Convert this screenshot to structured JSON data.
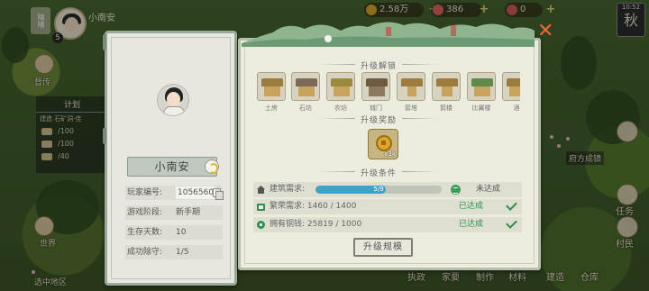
{
  "hud": {
    "player_name_top": "小南安",
    "player_level": "5",
    "weather_label": "晴晴",
    "resources": [
      {
        "icon": "copper-coin-icon",
        "value": "2.58万",
        "color": "#d9a52b"
      },
      {
        "icon": "scroll-icon",
        "value": "386",
        "color": "#e0665c"
      },
      {
        "icon": "gem-icon",
        "value": "0",
        "color": "#d45a5a"
      }
    ],
    "season_time": "10:52",
    "season": "秋"
  },
  "world": {
    "left_labels": [
      "督传",
      "世界",
      "选中地区"
    ],
    "plan": {
      "title": "计划",
      "subtitle": "建造 石矿洞·佳",
      "rows": [
        "/100",
        "/100",
        "/40"
      ]
    },
    "right_labels": [
      "府方成镜",
      "任务",
      "村民"
    ],
    "bottom_labels": [
      "执政",
      "家要",
      "制作",
      "材料",
      "建造",
      "仓库"
    ]
  },
  "profile": {
    "name": "小南安",
    "fields": [
      {
        "label": "玩家编号:",
        "value": "1056560"
      },
      {
        "label": "游戏阶段:",
        "value": "新手期"
      },
      {
        "label": "生存天数:",
        "value": "10"
      },
      {
        "label": "成功除守:",
        "value": "1/5"
      }
    ]
  },
  "upgrade": {
    "unlock_title": "升级解锁",
    "buildings": [
      "土房",
      "石坊",
      "农坊",
      "城门",
      "箭塔",
      "箭楼",
      "比翼楼",
      "酒"
    ],
    "reward_title": "升级奖励",
    "reward_amount": "x3k",
    "conditions_title": "升级条件",
    "conditions": [
      {
        "label": "建筑需求:",
        "progress_text": "5/9",
        "progress": 0.56,
        "status": "未达成"
      },
      {
        "label": "繁荣需求:  1460 / 1400",
        "status": "已达成"
      },
      {
        "label": "拥有铜钱:  25819 / 1000",
        "status": "已达成"
      }
    ],
    "button": "升级规模"
  },
  "colors": {
    "accent_green": "#2e8f4f",
    "progress_blue": "#3fa3c7",
    "close_orange": "#e8683a"
  }
}
